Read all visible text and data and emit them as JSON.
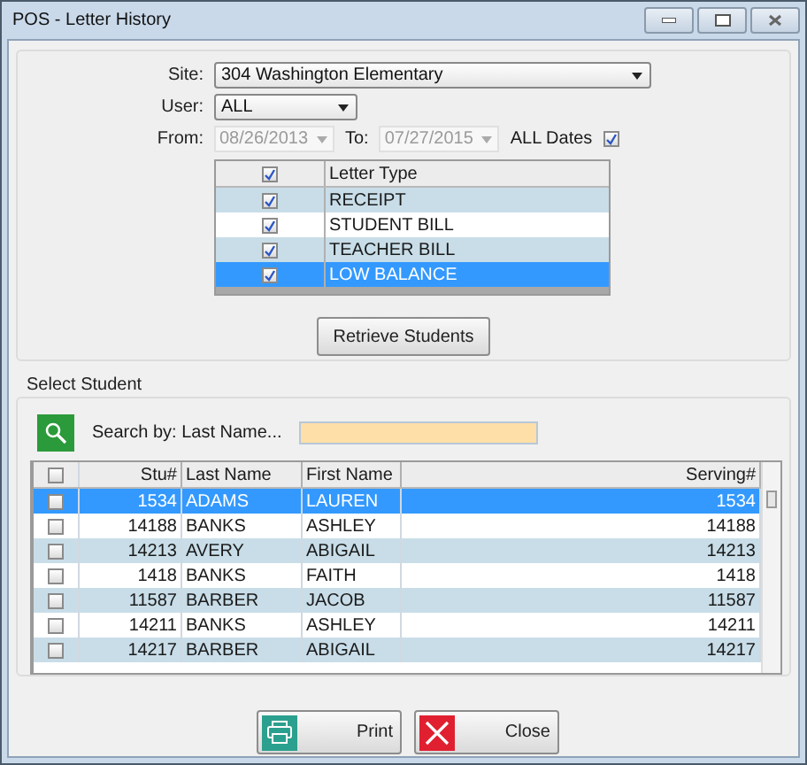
{
  "window": {
    "title": "POS - Letter History"
  },
  "filters": {
    "site": {
      "label": "Site:",
      "value": "304 Washington Elementary"
    },
    "user": {
      "label": "User:",
      "value": "ALL"
    },
    "from": {
      "label": "From:",
      "value": "08/26/2013",
      "disabled": true
    },
    "to": {
      "label": "To:",
      "value": "07/27/2015",
      "disabled": true
    },
    "all_dates": {
      "label": "ALL Dates",
      "checked": true
    }
  },
  "letter_types": {
    "header": "Letter Type",
    "header_checked": true,
    "rows": [
      {
        "label": "RECEIPT",
        "checked": true,
        "selected": false
      },
      {
        "label": "STUDENT BILL",
        "checked": true,
        "selected": false
      },
      {
        "label": "TEACHER BILL",
        "checked": true,
        "selected": false
      },
      {
        "label": "LOW BALANCE",
        "checked": true,
        "selected": true
      }
    ]
  },
  "retrieve_button": "Retrieve Students",
  "select_student": {
    "title": "Select Student",
    "search_label": "Search by: Last Name..."
  },
  "students": {
    "header_checked": false,
    "columns": [
      "Stu#",
      "Last Name",
      "First Name",
      "Serving#"
    ],
    "rows": [
      {
        "stu": "1534",
        "last": "ADAMS",
        "first": "LAUREN",
        "serving": "1534",
        "checked": false,
        "selected": true
      },
      {
        "stu": "14188",
        "last": "BANKS",
        "first": "ASHLEY",
        "serving": "14188",
        "checked": false,
        "selected": false
      },
      {
        "stu": "14213",
        "last": "AVERY",
        "first": "ABIGAIL",
        "serving": "14213",
        "checked": false,
        "selected": false
      },
      {
        "stu": "1418",
        "last": "BANKS",
        "first": "FAITH",
        "serving": "1418",
        "checked": false,
        "selected": false
      },
      {
        "stu": "11587",
        "last": "BARBER",
        "first": "JACOB",
        "serving": "11587",
        "checked": false,
        "selected": false
      },
      {
        "stu": "14211",
        "last": "BANKS",
        "first": "ASHLEY",
        "serving": "14211",
        "checked": false,
        "selected": false
      },
      {
        "stu": "14217",
        "last": "BARBER",
        "first": "ABIGAIL",
        "serving": "14217",
        "checked": false,
        "selected": false
      }
    ]
  },
  "buttons": [
    {
      "kind": "print",
      "label": "Print"
    },
    {
      "kind": "close",
      "label": "Close"
    }
  ]
}
